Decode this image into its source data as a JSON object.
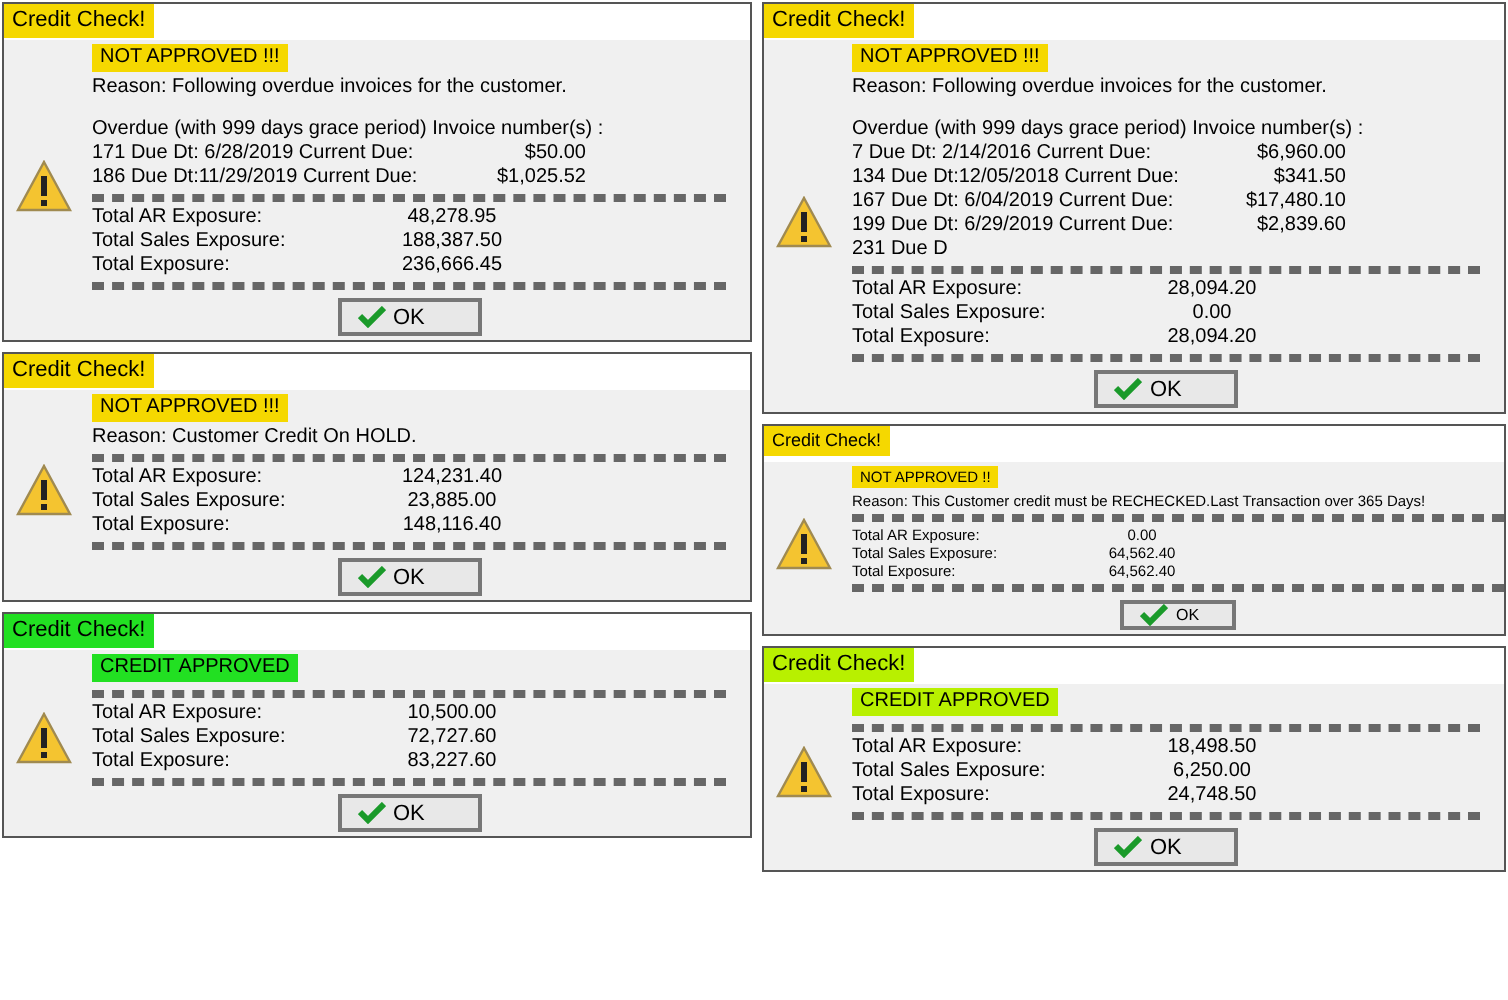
{
  "columns": [
    {
      "dialogs": [
        {
          "title": "Credit Check!",
          "color": "#f5d800",
          "compact": false,
          "status": "NOT APPROVED !!!",
          "reason": "Reason: Following overdue invoices for the customer.",
          "overdue_header": "Overdue (with 999 days grace period) Invoice number(s) :",
          "invoices": [
            {
              "label": "171 Due Dt: 6/28/2019 Current Due:",
              "amount": "$50.00"
            },
            {
              "label": "186 Due Dt:11/29/2019 Current Due:",
              "amount": "$1,025.52"
            }
          ],
          "totals": [
            {
              "label": "Total AR Exposure:",
              "value": "48,278.95"
            },
            {
              "label": "Total Sales Exposure:",
              "value": "188,387.50"
            },
            {
              "label": "Total Exposure:",
              "value": "236,666.45"
            }
          ],
          "button": "OK"
        },
        {
          "title": "Credit Check!",
          "color": "#f5d800",
          "compact": false,
          "status": "NOT APPROVED !!!",
          "reason": "Reason: Customer Credit On HOLD.",
          "totals": [
            {
              "label": "Total AR Exposure:",
              "value": "124,231.40"
            },
            {
              "label": "Total Sales Exposure:",
              "value": "23,885.00"
            },
            {
              "label": "Total Exposure:",
              "value": "148,116.40"
            }
          ],
          "button": "OK"
        },
        {
          "title": "Credit Check!",
          "color": "#22e022",
          "compact": false,
          "status": "CREDIT APPROVED",
          "totals": [
            {
              "label": "Total AR Exposure:",
              "value": "10,500.00"
            },
            {
              "label": "Total Sales Exposure:",
              "value": "72,727.60"
            },
            {
              "label": "Total Exposure:",
              "value": "83,227.60"
            }
          ],
          "button": "OK"
        }
      ]
    },
    {
      "dialogs": [
        {
          "title": "Credit Check!",
          "color": "#f5d800",
          "compact": false,
          "status": "NOT APPROVED !!!",
          "reason": "Reason: Following overdue invoices for the customer.",
          "overdue_header": "Overdue (with 999 days grace period) Invoice number(s) :",
          "invoices": [
            {
              "label": "7 Due Dt: 2/14/2016 Current Due:",
              "amount": "$6,960.00"
            },
            {
              "label": "134 Due Dt:12/05/2018 Current Due:",
              "amount": "$341.50"
            },
            {
              "label": "167 Due Dt: 6/04/2019 Current Due:",
              "amount": "$17,480.10"
            },
            {
              "label": "199 Due Dt: 6/29/2019 Current Due:",
              "amount": "$2,839.60"
            },
            {
              "label": "231 Due D"
            }
          ],
          "totals": [
            {
              "label": "Total AR Exposure:",
              "value": "28,094.20"
            },
            {
              "label": "Total Sales Exposure:",
              "value": "0.00"
            },
            {
              "label": "Total Exposure:",
              "value": "28,094.20"
            }
          ],
          "button": "OK"
        },
        {
          "title": "Credit Check!",
          "color": "#f5d800",
          "compact": true,
          "status": "NOT APPROVED !!",
          "reason": "Reason: This Customer credit must be RECHECKED.Last Transaction over 365 Days!",
          "totals": [
            {
              "label": "Total AR Exposure:",
              "value": "0.00"
            },
            {
              "label": "Total Sales Exposure:",
              "value": "64,562.40"
            },
            {
              "label": "Total Exposure:",
              "value": "64,562.40"
            }
          ],
          "button": "OK"
        },
        {
          "title": "Credit Check!",
          "color": "#b8f000",
          "compact": false,
          "status": "CREDIT APPROVED",
          "totals": [
            {
              "label": "Total AR Exposure:",
              "value": "18,498.50"
            },
            {
              "label": "Total Sales Exposure:",
              "value": "6,250.00"
            },
            {
              "label": "Total Exposure:",
              "value": "24,748.50"
            }
          ],
          "button": "OK"
        }
      ]
    }
  ]
}
